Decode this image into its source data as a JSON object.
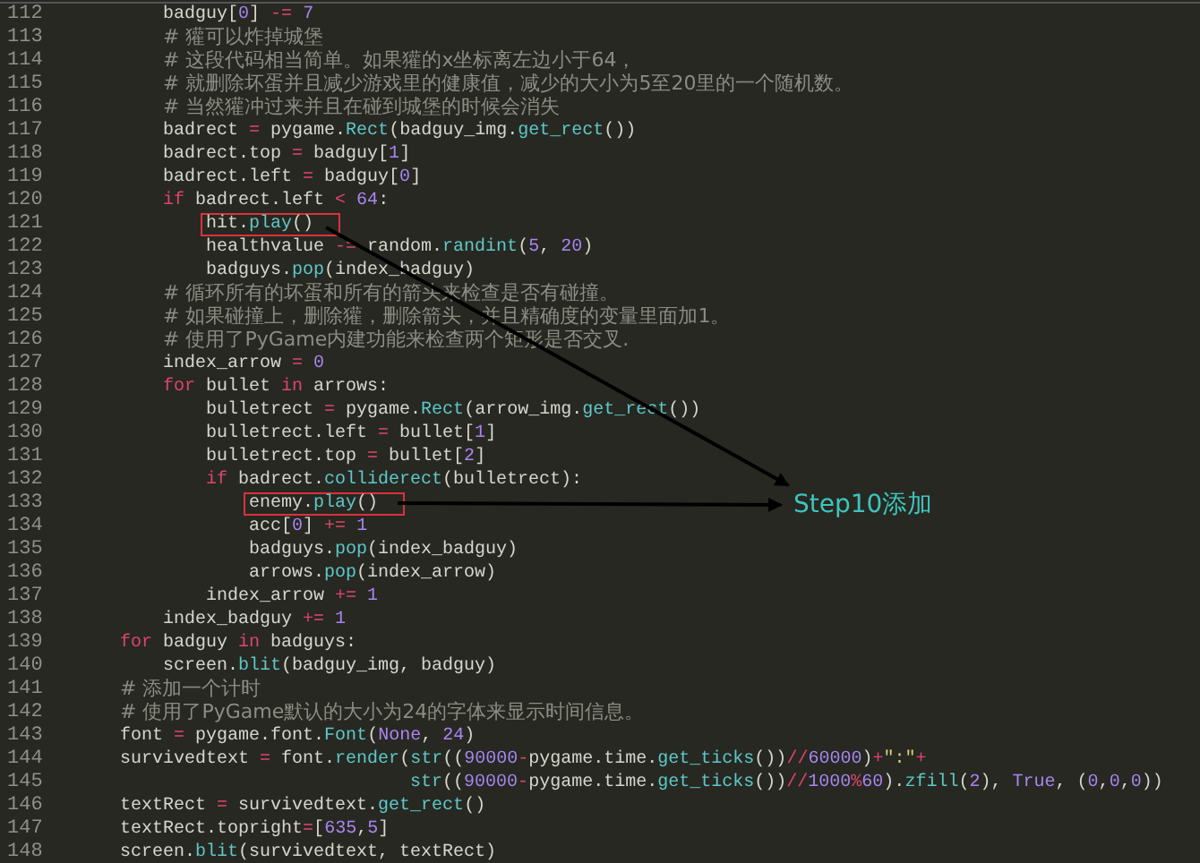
{
  "lines": [
    {
      "kind": "block",
      "children": [
        {
          "kind": "code",
          "no": "112",
          "boxed": false,
          "tokens": [
            {
              "text": "badguy[",
              "kind": "p"
            },
            {
              "text": "0",
              "kind": "n"
            },
            {
              "text": "] ",
              "kind": "p"
            },
            {
              "text": "-=",
              "kind": "o"
            },
            {
              "text": " 7",
              "kind": "n"
            }
          ]
        },
        {
          "kind": "comment",
          "no": "113",
          "boxed": false,
          "text": "# 獾可以炸掉城堡"
        },
        {
          "kind": "comment",
          "no": "114",
          "boxed": false,
          "text": "# 这段代码相当简单。如果獾的x坐标离左边小于64，"
        },
        {
          "kind": "comment",
          "no": "115",
          "boxed": false,
          "text": "# 就删除坏蛋并且减少游戏里的健康值，减少的大小为5至20里的一个随机数。"
        },
        {
          "kind": "comment",
          "no": "116",
          "boxed": false,
          "text": "# 当然獾冲过来并且在碰到城堡的时候会消失"
        },
        {
          "kind": "code",
          "no": "117",
          "boxed": false,
          "tokens": [
            {
              "text": "badrect ",
              "kind": "p"
            },
            {
              "text": "=",
              "kind": "o"
            },
            {
              "text": " pygame.",
              "kind": "p"
            },
            {
              "text": "Rect",
              "kind": "f"
            },
            {
              "text": "(badguy_img.",
              "kind": "p"
            },
            {
              "text": "get_rect",
              "kind": "f"
            },
            {
              "text": "())",
              "kind": "p"
            }
          ]
        },
        {
          "kind": "code",
          "no": "118",
          "boxed": false,
          "tokens": [
            {
              "text": "badrect.top ",
              "kind": "p"
            },
            {
              "text": "=",
              "kind": "o"
            },
            {
              "text": " badguy[",
              "kind": "p"
            },
            {
              "text": "1",
              "kind": "n"
            },
            {
              "text": "]",
              "kind": "p"
            }
          ]
        },
        {
          "kind": "code",
          "no": "119",
          "boxed": false,
          "tokens": [
            {
              "text": "badrect.left ",
              "kind": "p"
            },
            {
              "text": "=",
              "kind": "o"
            },
            {
              "text": " badguy[",
              "kind": "p"
            },
            {
              "text": "0",
              "kind": "n"
            },
            {
              "text": "]",
              "kind": "p"
            }
          ]
        },
        {
          "kind": "code",
          "no": "120",
          "boxed": false,
          "tokens": [
            {
              "text": "if",
              "kind": "k"
            },
            {
              "text": " badrect.left ",
              "kind": "p"
            },
            {
              "text": "<",
              "kind": "o"
            },
            {
              "text": " 64",
              "kind": "n"
            },
            {
              "text": ":",
              "kind": "p"
            }
          ],
          "children": [
            {
              "kind": "code",
              "no": "121",
              "boxed": true,
              "tokens": [
                {
                  "text": "hit.",
                  "kind": "p"
                },
                {
                  "text": "play",
                  "kind": "f"
                },
                {
                  "text": "()",
                  "kind": "p"
                }
              ]
            },
            {
              "kind": "code",
              "no": "122",
              "boxed": false,
              "tokens": [
                {
                  "text": "healthvalue ",
                  "kind": "p"
                },
                {
                  "text": "-=",
                  "kind": "o"
                },
                {
                  "text": " random.",
                  "kind": "p"
                },
                {
                  "text": "randint",
                  "kind": "f"
                },
                {
                  "text": "(",
                  "kind": "p"
                },
                {
                  "text": "5",
                  "kind": "n"
                },
                {
                  "text": ", ",
                  "kind": "p"
                },
                {
                  "text": "20",
                  "kind": "n"
                },
                {
                  "text": ")",
                  "kind": "p"
                }
              ]
            },
            {
              "kind": "code",
              "no": "123",
              "boxed": false,
              "tokens": [
                {
                  "text": "badguys.",
                  "kind": "p"
                },
                {
                  "text": "pop",
                  "kind": "f"
                },
                {
                  "text": "(index_badguy)",
                  "kind": "p"
                }
              ]
            }
          ]
        },
        {
          "kind": "comment",
          "no": "124",
          "boxed": false,
          "text": "# 循环所有的坏蛋和所有的箭头来检查是否有碰撞。"
        },
        {
          "kind": "comment",
          "no": "125",
          "boxed": false,
          "text": "# 如果碰撞上，删除獾，删除箭头，并且精确度的变量里面加1。"
        },
        {
          "kind": "comment",
          "no": "126",
          "boxed": false,
          "text": "# 使用了PyGame内建功能来检查两个矩形是否交叉."
        },
        {
          "kind": "code",
          "no": "127",
          "boxed": false,
          "tokens": [
            {
              "text": "index_arrow ",
              "kind": "p"
            },
            {
              "text": "=",
              "kind": "o"
            },
            {
              "text": " 0",
              "kind": "n"
            }
          ]
        },
        {
          "kind": "code",
          "no": "128",
          "boxed": false,
          "tokens": [
            {
              "text": "for",
              "kind": "k"
            },
            {
              "text": " bullet ",
              "kind": "p"
            },
            {
              "text": "in",
              "kind": "k"
            },
            {
              "text": " arrows:",
              "kind": "p"
            }
          ],
          "children": [
            {
              "kind": "code",
              "no": "129",
              "boxed": false,
              "tokens": [
                {
                  "text": "bulletrect ",
                  "kind": "p"
                },
                {
                  "text": "=",
                  "kind": "o"
                },
                {
                  "text": " pygame.",
                  "kind": "p"
                },
                {
                  "text": "Rect",
                  "kind": "f"
                },
                {
                  "text": "(arrow_img.",
                  "kind": "p"
                },
                {
                  "text": "get_rect",
                  "kind": "f"
                },
                {
                  "text": "())",
                  "kind": "p"
                }
              ]
            },
            {
              "kind": "code",
              "no": "130",
              "boxed": false,
              "tokens": [
                {
                  "text": "bulletrect.left ",
                  "kind": "p"
                },
                {
                  "text": "=",
                  "kind": "o"
                },
                {
                  "text": " bullet[",
                  "kind": "p"
                },
                {
                  "text": "1",
                  "kind": "n"
                },
                {
                  "text": "]",
                  "kind": "p"
                }
              ]
            },
            {
              "kind": "code",
              "no": "131",
              "boxed": false,
              "tokens": [
                {
                  "text": "bulletrect.top ",
                  "kind": "p"
                },
                {
                  "text": "=",
                  "kind": "o"
                },
                {
                  "text": " bullet[",
                  "kind": "p"
                },
                {
                  "text": "2",
                  "kind": "n"
                },
                {
                  "text": "]",
                  "kind": "p"
                }
              ]
            },
            {
              "kind": "code",
              "no": "132",
              "boxed": false,
              "tokens": [
                {
                  "text": "if",
                  "kind": "k"
                },
                {
                  "text": " badrect.",
                  "kind": "p"
                },
                {
                  "text": "colliderect",
                  "kind": "f"
                },
                {
                  "text": "(bulletrect):",
                  "kind": "p"
                }
              ],
              "children": [
                {
                  "kind": "code",
                  "no": "133",
                  "boxed": true,
                  "tokens": [
                    {
                      "text": "enemy.",
                      "kind": "p"
                    },
                    {
                      "text": "play",
                      "kind": "f"
                    },
                    {
                      "text": "()",
                      "kind": "p"
                    }
                  ]
                },
                {
                  "kind": "code",
                  "no": "134",
                  "boxed": false,
                  "tokens": [
                    {
                      "text": "acc[",
                      "kind": "p"
                    },
                    {
                      "text": "0",
                      "kind": "n"
                    },
                    {
                      "text": "] ",
                      "kind": "p"
                    },
                    {
                      "text": "+=",
                      "kind": "o"
                    },
                    {
                      "text": " 1",
                      "kind": "n"
                    }
                  ]
                },
                {
                  "kind": "code",
                  "no": "135",
                  "boxed": false,
                  "tokens": [
                    {
                      "text": "badguys.",
                      "kind": "p"
                    },
                    {
                      "text": "pop",
                      "kind": "f"
                    },
                    {
                      "text": "(index_badguy)",
                      "kind": "p"
                    }
                  ]
                },
                {
                  "kind": "code",
                  "no": "136",
                  "boxed": false,
                  "tokens": [
                    {
                      "text": "arrows.",
                      "kind": "p"
                    },
                    {
                      "text": "pop",
                      "kind": "f"
                    },
                    {
                      "text": "(index_arrow)",
                      "kind": "p"
                    }
                  ]
                }
              ]
            },
            {
              "kind": "code",
              "no": "137",
              "boxed": false,
              "tokens": [
                {
                  "text": "index_arrow ",
                  "kind": "p"
                },
                {
                  "text": "+=",
                  "kind": "o"
                },
                {
                  "text": " 1",
                  "kind": "n"
                }
              ]
            }
          ]
        },
        {
          "kind": "code",
          "no": "138",
          "boxed": false,
          "tokens": [
            {
              "text": "index_badguy ",
              "kind": "p"
            },
            {
              "text": "+=",
              "kind": "o"
            },
            {
              "text": " 1",
              "kind": "n"
            }
          ]
        }
      ]
    },
    {
      "kind": "code",
      "no": "139",
      "boxed": false,
      "tokens": [
        {
          "text": "for",
          "kind": "k"
        },
        {
          "text": " badguy ",
          "kind": "p"
        },
        {
          "text": "in",
          "kind": "k"
        },
        {
          "text": " badguys:",
          "kind": "p"
        }
      ],
      "children": [
        {
          "kind": "code",
          "no": "140",
          "boxed": false,
          "tokens": [
            {
              "text": "screen.",
              "kind": "p"
            },
            {
              "text": "blit",
              "kind": "f"
            },
            {
              "text": "(badguy_img, badguy)",
              "kind": "p"
            }
          ]
        }
      ]
    },
    {
      "kind": "comment",
      "no": "141",
      "boxed": false,
      "text": "# 添加一个计时"
    },
    {
      "kind": "comment",
      "no": "142",
      "boxed": false,
      "text": "# 使用了PyGame默认的大小为24的字体来显示时间信息。"
    },
    {
      "kind": "code",
      "no": "143",
      "boxed": false,
      "tokens": [
        {
          "text": "font ",
          "kind": "p"
        },
        {
          "text": "=",
          "kind": "o"
        },
        {
          "text": " pygame.font.",
          "kind": "p"
        },
        {
          "text": "Font",
          "kind": "f"
        },
        {
          "text": "(",
          "kind": "p"
        },
        {
          "text": "None",
          "kind": "n"
        },
        {
          "text": ", ",
          "kind": "p"
        },
        {
          "text": "24",
          "kind": "n"
        },
        {
          "text": ")",
          "kind": "p"
        }
      ]
    },
    {
      "kind": "code",
      "no": "144",
      "boxed": false,
      "tokens": [
        {
          "text": "survivedtext ",
          "kind": "p"
        },
        {
          "text": "=",
          "kind": "o"
        },
        {
          "text": " font.",
          "kind": "p"
        },
        {
          "text": "render",
          "kind": "f"
        },
        {
          "text": "(",
          "kind": "p"
        },
        {
          "text": "str",
          "kind": "f"
        },
        {
          "text": "((",
          "kind": "p"
        },
        {
          "text": "90000",
          "kind": "n"
        },
        {
          "text": "-",
          "kind": "o"
        },
        {
          "text": "pygame.time.",
          "kind": "p"
        },
        {
          "text": "get_ticks",
          "kind": "f"
        },
        {
          "text": "())",
          "kind": "p"
        },
        {
          "text": "//",
          "kind": "o"
        },
        {
          "text": "60000",
          "kind": "n"
        },
        {
          "text": ")",
          "kind": "p"
        },
        {
          "text": "+",
          "kind": "o"
        },
        {
          "text": "\":\"",
          "kind": "s"
        },
        {
          "text": "+",
          "kind": "o"
        }
      ]
    },
    {
      "kind": "continuation",
      "no": "145",
      "boxed": false,
      "tokens": [
        {
          "text": "str",
          "kind": "f"
        },
        {
          "text": "((",
          "kind": "p"
        },
        {
          "text": "90000",
          "kind": "n"
        },
        {
          "text": "-",
          "kind": "o"
        },
        {
          "text": "pygame.time.",
          "kind": "p"
        },
        {
          "text": "get_ticks",
          "kind": "f"
        },
        {
          "text": "())",
          "kind": "p"
        },
        {
          "text": "//",
          "kind": "o"
        },
        {
          "text": "1000",
          "kind": "n"
        },
        {
          "text": "%",
          "kind": "o"
        },
        {
          "text": "60",
          "kind": "n"
        },
        {
          "text": ").",
          "kind": "p"
        },
        {
          "text": "zfill",
          "kind": "f"
        },
        {
          "text": "(",
          "kind": "p"
        },
        {
          "text": "2",
          "kind": "n"
        },
        {
          "text": "), ",
          "kind": "p"
        },
        {
          "text": "True",
          "kind": "n"
        },
        {
          "text": ", (",
          "kind": "p"
        },
        {
          "text": "0",
          "kind": "n"
        },
        {
          "text": ",",
          "kind": "p"
        },
        {
          "text": "0",
          "kind": "n"
        },
        {
          "text": ",",
          "kind": "p"
        },
        {
          "text": "0",
          "kind": "n"
        },
        {
          "text": "))",
          "kind": "p"
        }
      ]
    },
    {
      "kind": "code",
      "no": "146",
      "boxed": false,
      "tokens": [
        {
          "text": "textRect ",
          "kind": "p"
        },
        {
          "text": "=",
          "kind": "o"
        },
        {
          "text": " survivedtext.",
          "kind": "p"
        },
        {
          "text": "get_rect",
          "kind": "f"
        },
        {
          "text": "()",
          "kind": "p"
        }
      ]
    },
    {
      "kind": "code",
      "no": "147",
      "boxed": false,
      "tokens": [
        {
          "text": "textRect.topright",
          "kind": "p"
        },
        {
          "text": "=",
          "kind": "o"
        },
        {
          "text": "[",
          "kind": "p"
        },
        {
          "text": "635",
          "kind": "n"
        },
        {
          "text": ",",
          "kind": "p"
        },
        {
          "text": "5",
          "kind": "n"
        },
        {
          "text": "]",
          "kind": "p"
        }
      ]
    },
    {
      "kind": "code",
      "no": "148",
      "boxed": false,
      "tokens": [
        {
          "text": "screen.",
          "kind": "p"
        },
        {
          "text": "blit",
          "kind": "f"
        },
        {
          "text": "(survivedtext, textRect)",
          "kind": "p"
        }
      ]
    }
  ],
  "annotation": {
    "label": "Step10添加"
  }
}
